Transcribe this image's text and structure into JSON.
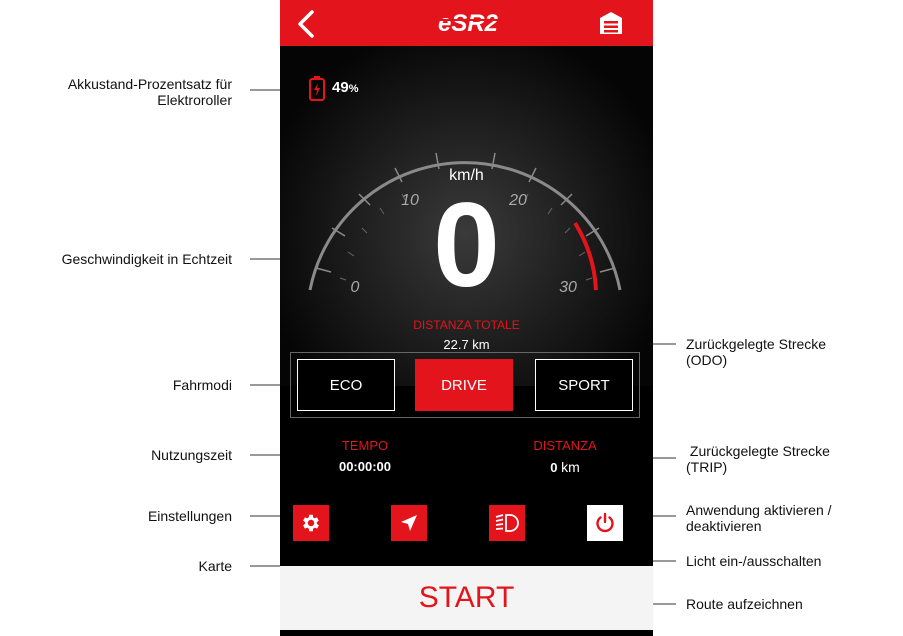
{
  "app": {
    "logo_text": "eSR2",
    "battery": {
      "value": "49",
      "unit": "%"
    },
    "speedometer": {
      "unit": "km/h",
      "speed": "0",
      "ticks": [
        "0",
        "10",
        "20",
        "30"
      ]
    },
    "odometer": {
      "label": "DISTANZA TOTALE",
      "value": "22.7 km"
    },
    "modes": [
      {
        "label": "ECO",
        "active": false
      },
      {
        "label": "DRIVE",
        "active": true
      },
      {
        "label": "SPORT",
        "active": false
      }
    ],
    "time": {
      "label": "TEMPO",
      "value": "00:00:00"
    },
    "trip": {
      "label": "DISTANZA",
      "value": "0",
      "unit": "km"
    },
    "buttons": {
      "settings_icon": "gear-icon",
      "map_icon": "navigation-arrow-icon",
      "light_icon": "headlight-icon",
      "power_icon": "power-icon"
    },
    "start_label": "START"
  },
  "annotations": {
    "battery": "Akkustand-Prozentsatz für\nElektroroller",
    "speed": "Geschwindigkeit in Echtzeit",
    "modes": "Fahrmodi",
    "time": "Nutzungszeit",
    "settings": "Einstellungen",
    "map": "Karte",
    "odo": "Zurückgelegte Strecke\n(ODO)",
    "trip": " Zurückgelegte Strecke\n(TRIP)",
    "power": "Anwendung aktivieren /\ndeaktivieren",
    "light": "Licht ein-/ausschalten",
    "start": "Route aufzeichnen"
  },
  "colors": {
    "accent": "#e3141b",
    "background": "#000000",
    "start_bg": "#f4f4f4"
  }
}
